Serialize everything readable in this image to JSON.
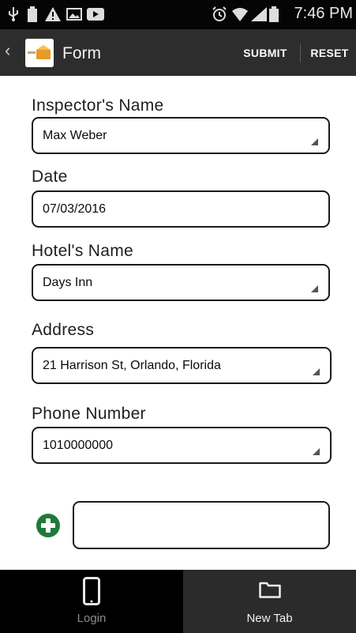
{
  "status_bar": {
    "time": "7:46 PM",
    "icons": [
      "usb-icon",
      "battery-full-icon",
      "warning-icon",
      "image-icon",
      "video-icon",
      "alarm-icon",
      "wifi-icon",
      "signal-icon",
      "battery-icon"
    ]
  },
  "action_bar": {
    "title": "Form",
    "submit_label": "SUBMIT",
    "reset_label": "RESET"
  },
  "form": {
    "fields": [
      {
        "label": "Inspector's Name",
        "value": "Max Weber"
      },
      {
        "label": "Date",
        "value": "07/03/2016"
      },
      {
        "label": "Hotel's Name",
        "value": "Days Inn"
      },
      {
        "label": "Address",
        "value": "21 Harrison St, Orlando, Florida"
      },
      {
        "label": "Phone Number",
        "value": "1010000000"
      }
    ],
    "add_field_value": ""
  },
  "bottom_tabs": [
    {
      "label": "Login",
      "icon": "phone-icon"
    },
    {
      "label": "New Tab",
      "icon": "folder-icon"
    }
  ],
  "colors": {
    "status_bar_bg": "#050505",
    "action_bar_bg": "#2d2d2d",
    "add_icon_green": "#1e7a3a",
    "tab_login_bg": "#000000",
    "tab_newtab_bg": "#2b2b2b"
  }
}
